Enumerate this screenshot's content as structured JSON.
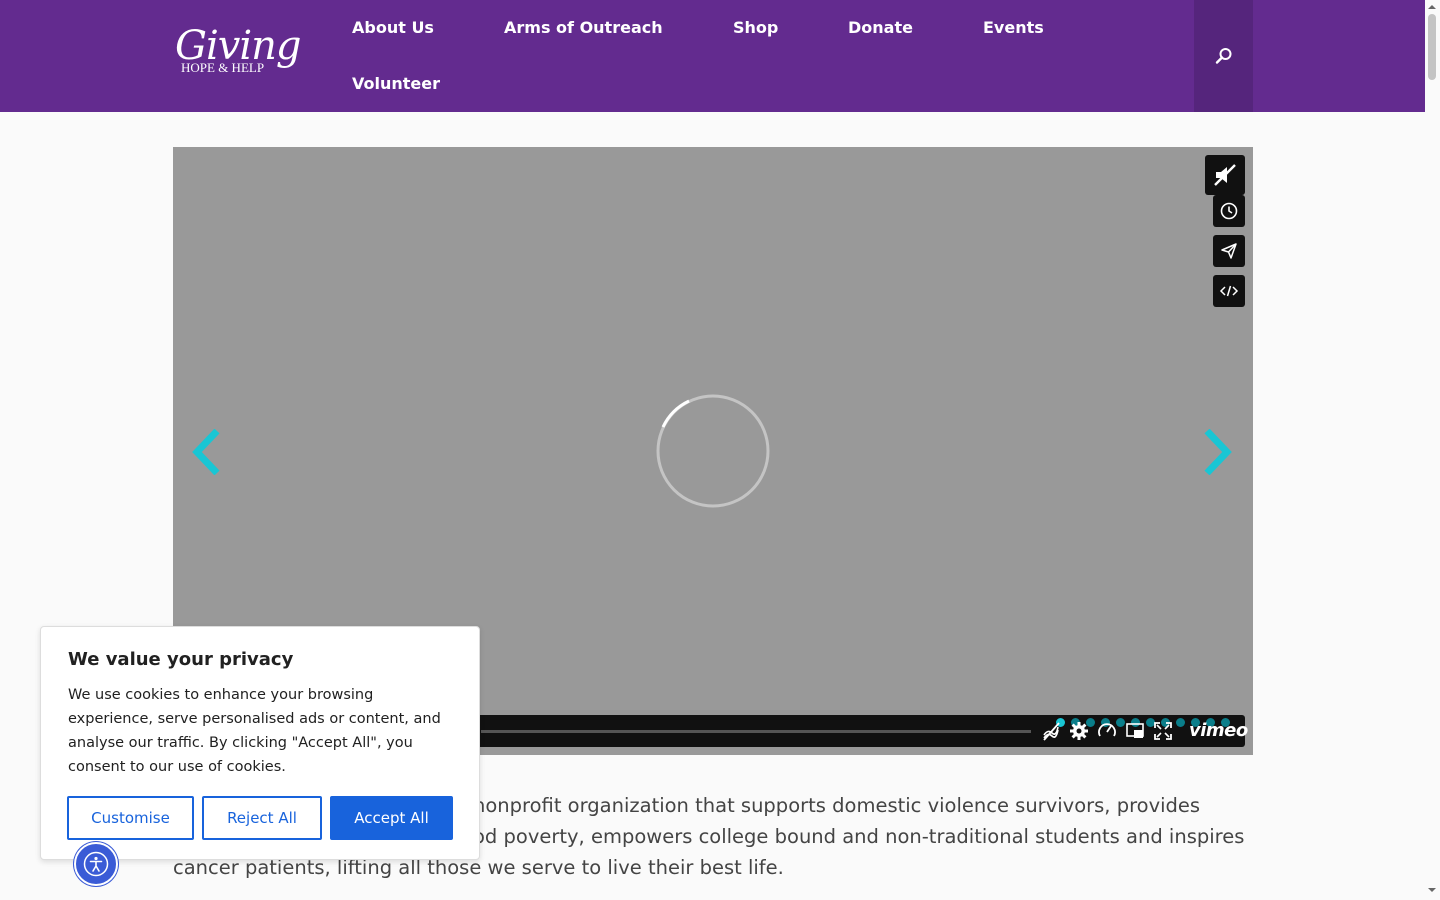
{
  "logo": {
    "script_text": "Giving",
    "sub_text": "HOPE & HELP"
  },
  "nav": {
    "items": [
      {
        "label": "About Us"
      },
      {
        "label": "Arms of Outreach"
      },
      {
        "label": "Shop"
      },
      {
        "label": "Donate"
      },
      {
        "label": "Events"
      },
      {
        "label": "Volunteer"
      }
    ],
    "search_icon": "search-icon"
  },
  "video": {
    "state": "loading",
    "side_buttons": [
      "muted-speaker-icon",
      "clock-icon",
      "send-icon",
      "embed-code-icon"
    ],
    "control_icons": [
      "no-audio-icon",
      "gear-icon",
      "speed-gauge-icon",
      "picture-in-picture-icon",
      "fullscreen-icon"
    ],
    "brand": "vimeo",
    "dot_count": 12,
    "accent_color": "#19c6d4"
  },
  "intro": {
    "text": "nonprofit organization that supports domestic violence survivors, provides od poverty, empowers college bound and non-traditional students and inspires cancer patients, lifting all those we serve to live their best life."
  },
  "intro_lines": [
    "nonprofit organization that supports domestic violence survivors, provides",
    "od poverty, empowers college bound and non-traditional students and inspires",
    "cancer patients, lifting all those we serve to live their best life."
  ],
  "cookie": {
    "title": "We value your privacy",
    "text": "We use cookies to enhance your browsing experience, serve personalised ads or content, and analyse our traffic. By clicking \"Accept All\", you consent to our use of cookies.",
    "customise": "Customise",
    "reject": "Reject All",
    "accept": "Accept All"
  },
  "colors": {
    "header": "#632b8f",
    "button": "#1863dc",
    "accessibility": "#3a5bd6"
  }
}
